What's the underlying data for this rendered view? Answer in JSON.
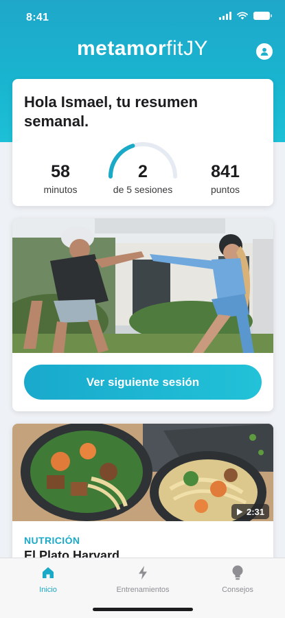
{
  "status_bar": {
    "time": "8:41"
  },
  "header": {
    "logo_bold": "metamor",
    "logo_thin": "fitJY"
  },
  "summary": {
    "title": "Hola Ismael, tu resumen semanal.",
    "stats": [
      {
        "value": "58",
        "label": "minutos"
      },
      {
        "value": "2",
        "label": "de 5 sesiones"
      },
      {
        "value": "841",
        "label": "puntos"
      }
    ],
    "sessions_progress": 0.4
  },
  "session": {
    "button_label": "Ver siguiente sesión"
  },
  "article": {
    "category": "NUTRICIÓN",
    "title": "El Plato Harvard",
    "video_duration": "2:31"
  },
  "tabs": [
    {
      "label": "Inicio",
      "icon": "home-icon",
      "active": true
    },
    {
      "label": "Entrenamientos",
      "icon": "bolt-icon",
      "active": false
    },
    {
      "label": "Consejos",
      "icon": "lightbulb-icon",
      "active": false
    }
  ],
  "colors": {
    "accent": "#1aa9c7",
    "header_bg": "#1fb0cc",
    "inactive_tab": "#8e8e93"
  }
}
